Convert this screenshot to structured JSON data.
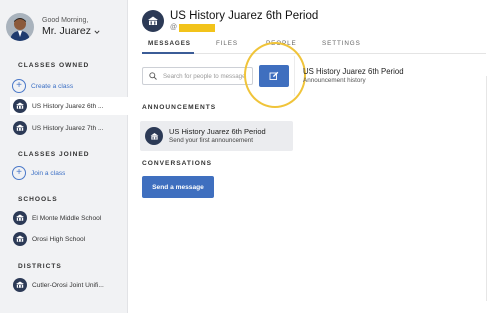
{
  "profile": {
    "greeting": "Good Morning,",
    "name": "Mr. Juarez"
  },
  "sidebar": {
    "classes_owned_title": "CLASSES OWNED",
    "create_class": "Create a class",
    "owned": [
      {
        "label": "US History Juarez 6th ...",
        "active": true
      },
      {
        "label": "US History Juarez 7th ...",
        "active": false
      }
    ],
    "classes_joined_title": "CLASSES JOINED",
    "join_class": "Join a class",
    "schools_title": "SCHOOLS",
    "schools": [
      {
        "label": "El Monte Middle School"
      },
      {
        "label": "Orosi High School"
      }
    ],
    "districts_title": "DISTRICTS",
    "districts": [
      {
        "label": "Cutler-Orosi Joint Unifi..."
      }
    ]
  },
  "header": {
    "title": "US History Juarez 6th Period",
    "sub_prefix": "@"
  },
  "tabs": [
    {
      "label": "MESSAGES",
      "active": true
    },
    {
      "label": "FILES",
      "active": false
    },
    {
      "label": "PEOPLE",
      "active": false
    },
    {
      "label": "SETTINGS",
      "active": false
    }
  ],
  "search": {
    "placeholder": "Search for people to message"
  },
  "announcements": {
    "title": "ANNOUNCEMENTS",
    "item_name": "US History Juarez 6th Period",
    "item_sub": "Send your first announcement"
  },
  "conversations": {
    "title": "CONVERSATIONS",
    "send_button": "Send a message"
  },
  "right_panel": {
    "title": "US History Juarez 6th Period",
    "sub": "Announcement history"
  },
  "colors": {
    "accent": "#3f6fbf",
    "highlight": "#f0c43a",
    "redaction": "#f2c31a",
    "sidebar_bg": "#f1f2f4"
  },
  "icons": [
    "user-avatar",
    "chevron-down-icon",
    "plus-circle-icon",
    "school-building-icon",
    "search-icon",
    "compose-icon"
  ]
}
